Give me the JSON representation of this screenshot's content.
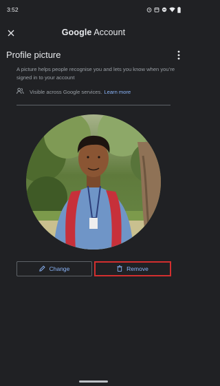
{
  "status_bar": {
    "time": "3:52",
    "icons": [
      "alarm-icon",
      "calendar-icon",
      "dnd-icon",
      "wifi-icon",
      "battery-icon"
    ]
  },
  "app_bar": {
    "close_icon": "close-icon",
    "title_brand": "Google",
    "title_rest": " Account"
  },
  "page": {
    "title": "Profile picture",
    "more_icon": "more-vert-icon",
    "description": "A picture helps people recognise you and lets you know when you’re signed in to your account",
    "visibility_text": "Visible across Google services.",
    "learn_more": "Learn more",
    "visibility_icon": "people-icon"
  },
  "actions": {
    "change_label": "Change",
    "change_icon": "pencil-icon",
    "remove_label": "Remove",
    "remove_icon": "trash-icon"
  },
  "colors": {
    "background": "#202124",
    "accent": "#8ab4f8",
    "highlight": "#d32f2f"
  }
}
